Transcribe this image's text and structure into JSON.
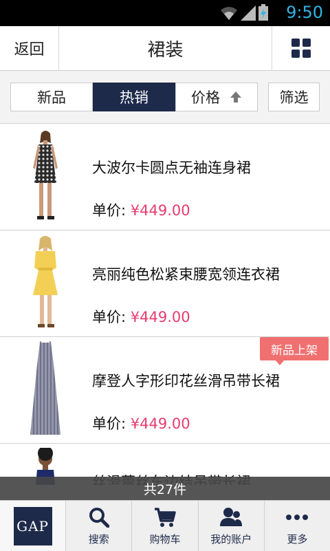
{
  "status_bar": {
    "time": "9:50"
  },
  "header": {
    "back_label": "返回",
    "title": "裙装"
  },
  "filters": {
    "new_label": "新品",
    "hot_label": "热销",
    "price_label": "价格",
    "filter_label": "筛选"
  },
  "products": [
    {
      "name": "大波尔卡圆点无袖连身裙",
      "price_label": "单价:",
      "price": "¥449.00",
      "badge": "",
      "dress_color": "#3b3b3b",
      "dress_pattern": "dots"
    },
    {
      "name": "亮丽纯色松紧束腰宽领连衣裙",
      "price_label": "单价:",
      "price": "¥449.00",
      "badge": "",
      "dress_color": "#f3d055",
      "dress_pattern": "solid"
    },
    {
      "name": "摩登人字形印花丝滑吊带长裙",
      "price_label": "单价:",
      "price": "¥449.00",
      "badge": "新品上架",
      "dress_color": "#8d8fa6",
      "dress_pattern": "stripes"
    },
    {
      "name": "丝滑蕾丝车边结吊带长裙",
      "dress_color": "#1e2a6a"
    }
  ],
  "count_label": "共27件",
  "tabbar": {
    "logo_text": "GAP",
    "search_label": "搜索",
    "cart_label": "购物车",
    "account_label": "我的账户",
    "more_label": "更多"
  },
  "colors": {
    "navy": "#1e2a4a",
    "price_pink": "#e63c6e",
    "badge_red": "#f07070",
    "status_blue": "#33b5e5"
  }
}
